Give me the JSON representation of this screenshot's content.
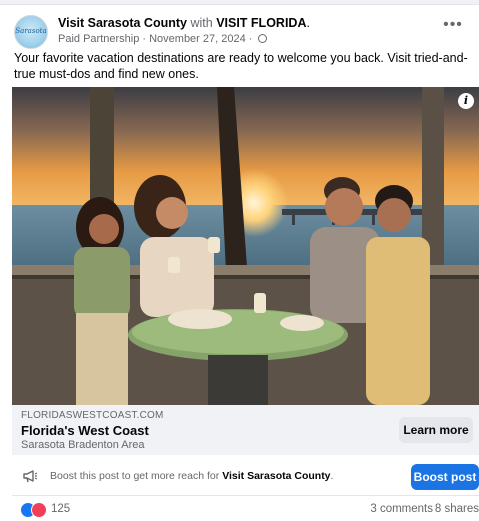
{
  "post": {
    "page_name": "Visit Sarasota County",
    "with_word": "with",
    "partner_name": "VISIT FLORIDA",
    "meta": "Paid Partnership · November 27, 2024 ·",
    "avatar_text": "Sarasota",
    "caption": "Your favorite vacation destinations are ready to welcome you back. Visit tried-and-true must-dos and find new ones.",
    "more_label": "•••"
  },
  "link": {
    "domain": "FLORIDASWESTCOAST.COM",
    "title": "Florida's West Coast",
    "subtitle": "Sarasota Bradenton Area",
    "cta_label": "Learn more"
  },
  "boost": {
    "text_prefix": "Boost this post to get more reach for",
    "page_name": "Visit Sarasota County",
    "text_suffix": ".",
    "button_label": "Boost post"
  },
  "stats": {
    "reaction_count": "125",
    "comments": "3 comments",
    "shares": "8 shares"
  },
  "colors": {
    "accent": "#1b74e4",
    "like": "#1877f2",
    "love": "#f33e58",
    "secondary_text": "#65676b"
  },
  "icons": [
    "info-icon",
    "megaphone-icon",
    "globe-icon",
    "more-icon"
  ]
}
